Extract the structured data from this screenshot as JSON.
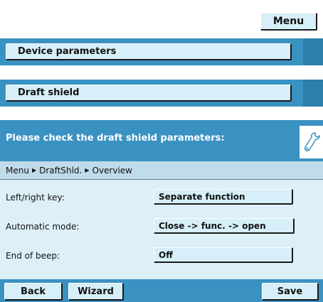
{
  "menu_button": "Menu",
  "nav": {
    "device_parameters": "Device parameters",
    "draft_shield": "Draft shield"
  },
  "dialog": {
    "title": "Please check the draft shield parameters:",
    "breadcrumb": [
      "Menu",
      "DraftShld.",
      "Overview"
    ],
    "rows": [
      {
        "label": "Left/right key:",
        "value": "Separate function"
      },
      {
        "label": "Automatic mode:",
        "value": "Close -> func. -> open"
      },
      {
        "label": "End of beep:",
        "value": "Off"
      }
    ]
  },
  "footer": {
    "back": "Back",
    "wizard": "Wizard",
    "save": "Save"
  },
  "icons": {
    "wrench": "wrench-icon",
    "breadcrumb_separator": "triangle-right-icon"
  },
  "colors": {
    "panel_blue": "#3a92c2",
    "body_light": "#ddf0f8",
    "button_face": "#d6eff8"
  }
}
